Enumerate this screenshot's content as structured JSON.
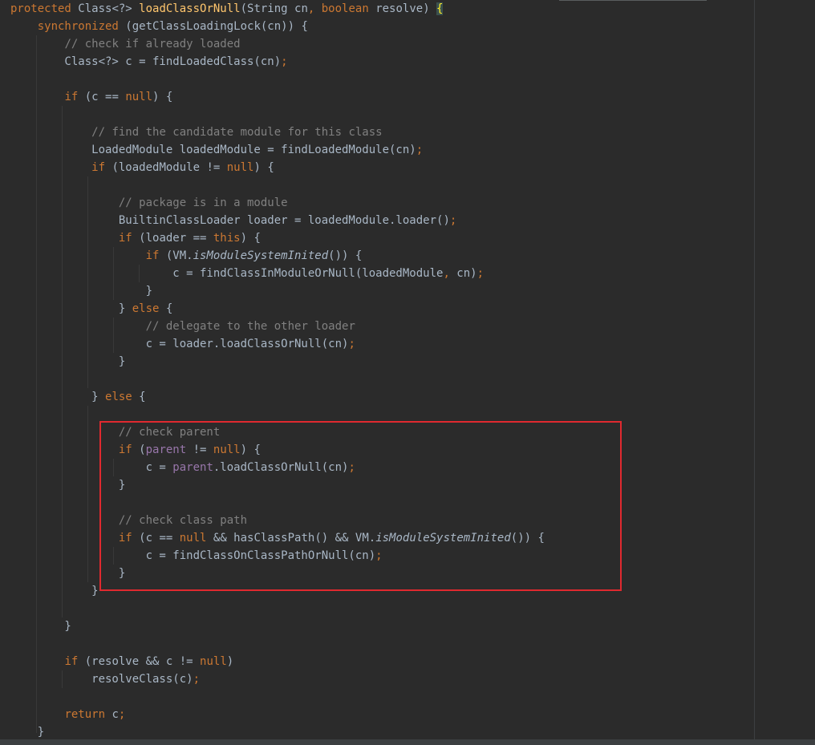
{
  "editor": {
    "language": "java",
    "theme_colors": {
      "background": "#2b2b2b",
      "keyword": "#cc7832",
      "method_declaration": "#ffc66d",
      "comment": "#808080",
      "identifier": "#a9b7c6",
      "field": "#9876aa",
      "highlight_box": "#e0292f"
    },
    "lines": [
      [
        [
          "kw",
          "protected "
        ],
        [
          "id",
          "Class<?> "
        ],
        [
          "fn",
          "loadClassOrNull"
        ],
        [
          "id",
          "(String cn"
        ],
        [
          "kw",
          ", "
        ],
        [
          "kw",
          "boolean "
        ],
        [
          "id",
          "resolve) "
        ],
        [
          "brace-hl",
          "{"
        ]
      ],
      [
        [
          "id",
          "    "
        ],
        [
          "kw",
          "synchronized "
        ],
        [
          "id",
          "(getClassLoadingLock(cn)) {"
        ]
      ],
      [
        [
          "id",
          "        "
        ],
        [
          "cm",
          "// check if already loaded"
        ]
      ],
      [
        [
          "id",
          "        Class<?> c = findLoadedClass(cn)"
        ],
        [
          "kw",
          ";"
        ]
      ],
      [],
      [
        [
          "id",
          "        "
        ],
        [
          "kw",
          "if "
        ],
        [
          "id",
          "(c == "
        ],
        [
          "kw",
          "null"
        ],
        [
          "id",
          ") {"
        ]
      ],
      [],
      [
        [
          "id",
          "            "
        ],
        [
          "cm",
          "// find the candidate module for this class"
        ]
      ],
      [
        [
          "id",
          "            LoadedModule loadedModule = findLoadedModule(cn)"
        ],
        [
          "kw",
          ";"
        ]
      ],
      [
        [
          "id",
          "            "
        ],
        [
          "kw",
          "if "
        ],
        [
          "id",
          "(loadedModule != "
        ],
        [
          "kw",
          "null"
        ],
        [
          "id",
          ") {"
        ]
      ],
      [],
      [
        [
          "id",
          "                "
        ],
        [
          "cm",
          "// package is in a module"
        ]
      ],
      [
        [
          "id",
          "                BuiltinClassLoader loader = loadedModule.loader()"
        ],
        [
          "kw",
          ";"
        ]
      ],
      [
        [
          "id",
          "                "
        ],
        [
          "kw",
          "if "
        ],
        [
          "id",
          "(loader == "
        ],
        [
          "kw",
          "this"
        ],
        [
          "id",
          ") {"
        ]
      ],
      [
        [
          "id",
          "                    "
        ],
        [
          "kw",
          "if "
        ],
        [
          "id",
          "(VM."
        ],
        [
          "it",
          "isModuleSystemInited"
        ],
        [
          "id",
          "()) {"
        ]
      ],
      [
        [
          "id",
          "                        c = findClassInModuleOrNull(loadedModule"
        ],
        [
          "kw",
          ", "
        ],
        [
          "id",
          "cn)"
        ],
        [
          "kw",
          ";"
        ]
      ],
      [
        [
          "id",
          "                    }"
        ]
      ],
      [
        [
          "id",
          "                } "
        ],
        [
          "kw",
          "else "
        ],
        [
          "id",
          "{"
        ]
      ],
      [
        [
          "id",
          "                    "
        ],
        [
          "cm",
          "// delegate to the other loader"
        ]
      ],
      [
        [
          "id",
          "                    c = loader.loadClassOrNull(cn)"
        ],
        [
          "kw",
          ";"
        ]
      ],
      [
        [
          "id",
          "                }"
        ]
      ],
      [],
      [
        [
          "id",
          "            } "
        ],
        [
          "kw",
          "else "
        ],
        [
          "id",
          "{"
        ]
      ],
      [],
      [
        [
          "id",
          "                "
        ],
        [
          "cm",
          "// check parent"
        ]
      ],
      [
        [
          "id",
          "                "
        ],
        [
          "kw",
          "if "
        ],
        [
          "id",
          "("
        ],
        [
          "fld",
          "parent"
        ],
        [
          "id",
          " != "
        ],
        [
          "kw",
          "null"
        ],
        [
          "id",
          ") {"
        ]
      ],
      [
        [
          "id",
          "                    c = "
        ],
        [
          "fld",
          "parent"
        ],
        [
          "id",
          ".loadClassOrNull(cn)"
        ],
        [
          "kw",
          ";"
        ]
      ],
      [
        [
          "id",
          "                }"
        ]
      ],
      [],
      [
        [
          "id",
          "                "
        ],
        [
          "cm",
          "// check class path"
        ]
      ],
      [
        [
          "id",
          "                "
        ],
        [
          "kw",
          "if "
        ],
        [
          "id",
          "(c == "
        ],
        [
          "kw",
          "null "
        ],
        [
          "id",
          "&& hasClassPath() && VM."
        ],
        [
          "it",
          "isModuleSystemInited"
        ],
        [
          "id",
          "()) {"
        ]
      ],
      [
        [
          "id",
          "                    c = findClassOnClassPathOrNull(cn)"
        ],
        [
          "kw",
          ";"
        ]
      ],
      [
        [
          "id",
          "                }"
        ]
      ],
      [
        [
          "id",
          "            }"
        ]
      ],
      [],
      [
        [
          "id",
          "        }"
        ]
      ],
      [],
      [
        [
          "id",
          "        "
        ],
        [
          "kw",
          "if "
        ],
        [
          "id",
          "(resolve && c != "
        ],
        [
          "kw",
          "null"
        ],
        [
          "id",
          ")"
        ]
      ],
      [
        [
          "id",
          "            resolveClass(c)"
        ],
        [
          "kw",
          ";"
        ]
      ],
      [],
      [
        [
          "id",
          "        "
        ],
        [
          "kw",
          "return "
        ],
        [
          "id",
          "c"
        ],
        [
          "kw",
          ";"
        ]
      ],
      [
        [
          "id",
          "    }"
        ]
      ]
    ]
  }
}
